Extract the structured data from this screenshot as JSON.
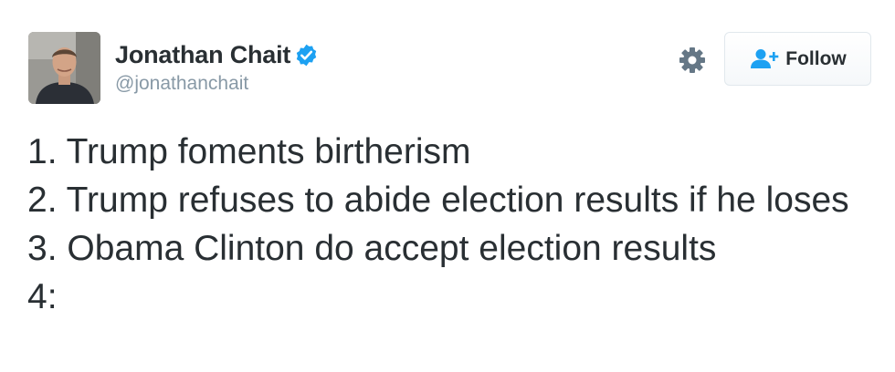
{
  "author": {
    "display_name": "Jonathan Chait",
    "handle": "@jonathanchait",
    "verified": true
  },
  "actions": {
    "follow_label": "Follow"
  },
  "icons": {
    "verified": "verified-badge-icon",
    "settings": "gear-icon",
    "follow": "add-user-icon"
  },
  "colors": {
    "verified_blue": "#1da1f2",
    "follow_icon_blue": "#1da1f2",
    "text": "#292f33",
    "handle_gray": "#8899a6"
  },
  "tweet": {
    "lines": [
      "1. Trump foments birtherism",
      "2. Trump refuses to abide election results if he loses",
      "3. Obama Clinton do accept election results",
      "4:"
    ]
  }
}
